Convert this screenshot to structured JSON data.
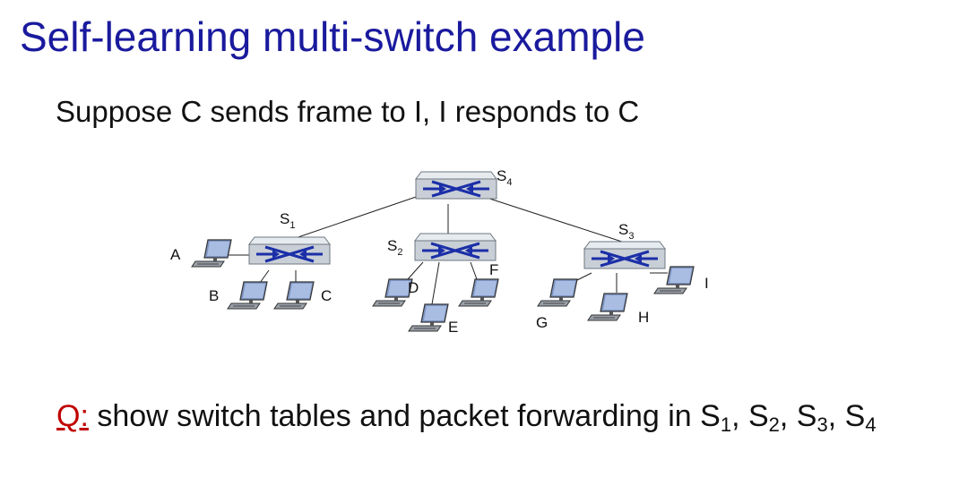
{
  "slide": {
    "title": "Self-learning multi-switch example",
    "subtitle": "Suppose C sends frame to I, I responds to C",
    "question": {
      "prefix": "Q:",
      "text": " show switch tables and packet forwarding in S",
      "subscripts": [
        "1",
        "2",
        "3",
        "4"
      ]
    }
  },
  "diagram": {
    "switches": [
      {
        "id": "S4",
        "letter": "S",
        "subscript": "4"
      },
      {
        "id": "S1",
        "letter": "S",
        "subscript": "1"
      },
      {
        "id": "S2",
        "letter": "S",
        "subscript": "2"
      },
      {
        "id": "S3",
        "letter": "S",
        "subscript": "3"
      }
    ],
    "hosts": [
      "A",
      "B",
      "C",
      "D",
      "E",
      "F",
      "G",
      "H",
      "I"
    ],
    "colors": {
      "switch_body": "#c9cfd6",
      "switch_top": "#e6ebf0",
      "switch_arrows": "#1b2fa8",
      "title": "#1a1a9e",
      "question_prefix": "#c00000"
    }
  }
}
